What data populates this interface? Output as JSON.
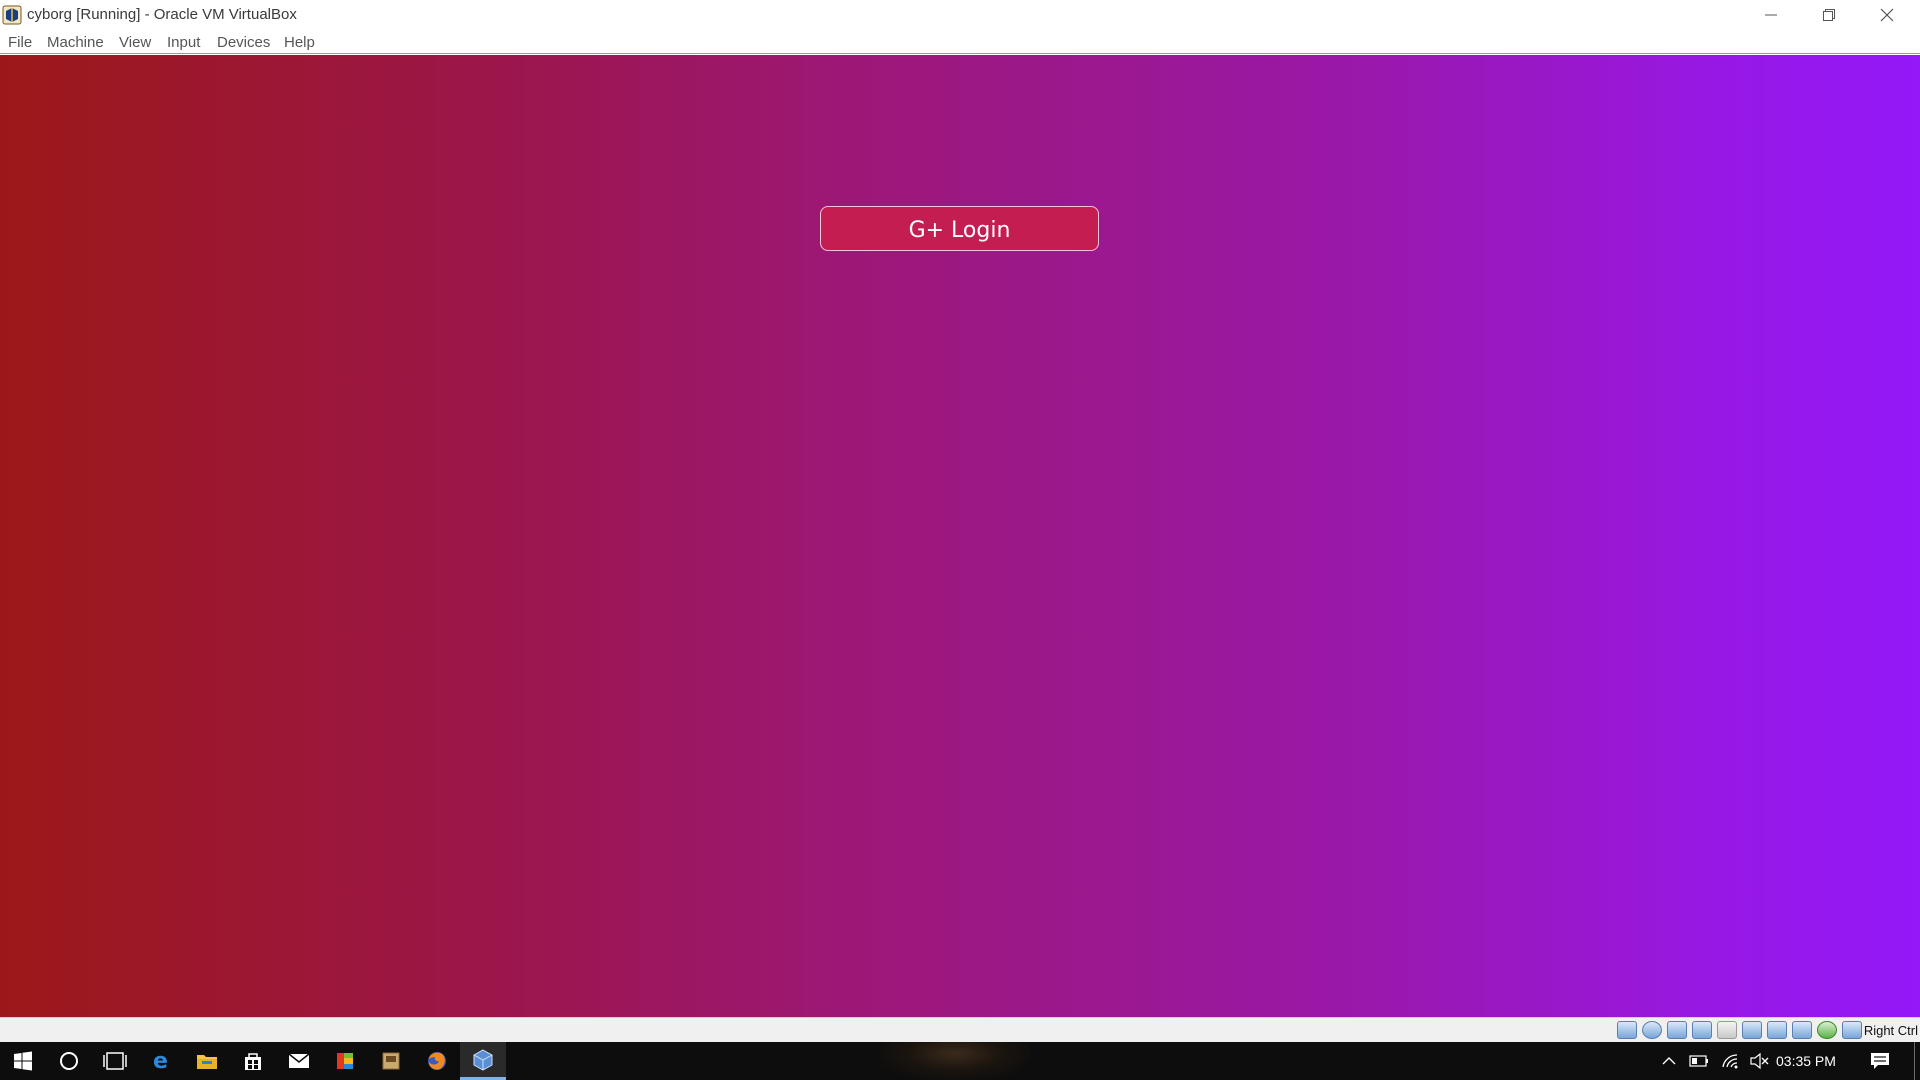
{
  "window": {
    "title": "cyborg [Running] - Oracle VM VirtualBox",
    "app_icon": "virtualbox-icon",
    "controls": [
      "minimize-icon",
      "restore-icon",
      "close-icon"
    ]
  },
  "menu": {
    "items": [
      {
        "label": "File"
      },
      {
        "label": "Machine"
      },
      {
        "label": "View"
      },
      {
        "label": "Input"
      },
      {
        "label": "Devices"
      },
      {
        "label": "Help"
      }
    ]
  },
  "vm": {
    "background_colors": [
      "#9c1818",
      "#9418f8"
    ],
    "login_button": {
      "label": "G+ Login",
      "color": "#c41d52"
    }
  },
  "statusbar": {
    "icons": [
      "hard-disk-icon",
      "optical-drive-icon",
      "audio-icon",
      "network-icon",
      "usb-icon",
      "shared-folders-icon",
      "display-icon",
      "video-capture-icon",
      "cpu-icon",
      "mouse-integration-icon",
      "keyboard-icon"
    ],
    "host_key": "Right Ctrl"
  },
  "taskbar": {
    "apps": [
      "windows-start-icon",
      "cortana-icon",
      "task-view-icon",
      "edge-icon",
      "file-explorer-icon",
      "store-icon",
      "mail-icon",
      "office-icon",
      "app-icon",
      "firefox-icon",
      "virtualbox-icon"
    ],
    "tray": [
      "chevron-up-icon",
      "battery-icon",
      "wifi-icon",
      "volume-muted-icon"
    ],
    "clock": "03:35 PM"
  }
}
